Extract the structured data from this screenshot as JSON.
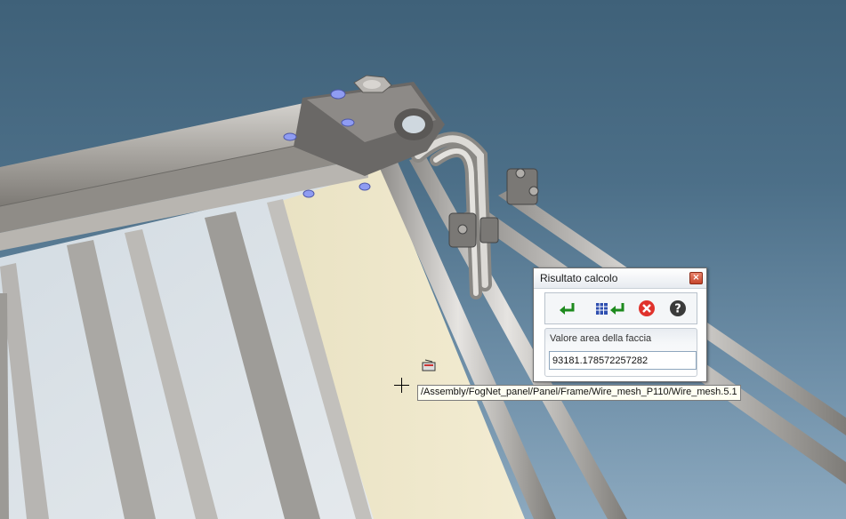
{
  "dialog": {
    "title": "Risultato calcolo",
    "close_label": "×",
    "toolbar": [
      {
        "name": "accept-icon"
      },
      {
        "name": "table-export-icon"
      },
      {
        "name": "cancel-icon"
      },
      {
        "name": "help-icon"
      }
    ],
    "result_label": "Valore area della faccia",
    "result_value": "93181.178572257282"
  },
  "tooltip": {
    "path": "/Assembly/FogNet_panel/Panel/Frame/Wire_mesh_P110/Wire_mesh.5.1"
  },
  "colors": {
    "background_top": "#3f6179",
    "background_bottom": "#8ca9bf",
    "highlight_face": "#efe6c5",
    "bolt_blue": "#8f9cf2",
    "close_red": "#c5452c"
  }
}
